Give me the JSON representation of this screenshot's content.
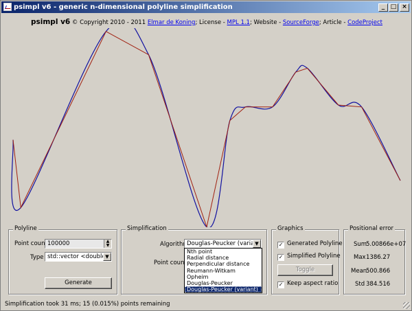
{
  "window": {
    "title": "psimpl v6 - generic n-dimensional polyline simplification",
    "controls": {
      "minimize": "_",
      "maximize": "□",
      "close": "×"
    }
  },
  "header": {
    "app_name": "psimpl v6",
    "copyright": " © Copyright 2010 - 2011 ",
    "author_link": "Elmar de Koning",
    "license_label": "; License - ",
    "license_link": "MPL 1.1",
    "website_label": "; Website - ",
    "website_link": "SourceForge",
    "article_label": "; Article - ",
    "article_link": "CodeProject"
  },
  "colors": {
    "generated": "#1010a0",
    "simplified": "#a02010",
    "selection": "#0a246a"
  },
  "plot": {
    "ymax": 1,
    "simplified_points": [
      [
        0.0,
        0.43
      ],
      [
        0.02,
        0.08
      ],
      [
        0.24,
        0.99
      ],
      [
        0.35,
        0.87
      ],
      [
        0.5,
        -0.02
      ],
      [
        0.56,
        0.53
      ],
      [
        0.6,
        0.6
      ],
      [
        0.67,
        0.6
      ],
      [
        0.73,
        0.78
      ],
      [
        0.76,
        0.8
      ],
      [
        0.84,
        0.61
      ],
      [
        0.9,
        0.6
      ],
      [
        1.0,
        0.22
      ]
    ]
  },
  "polyline": {
    "title": "Polyline",
    "point_count_label": "Point count",
    "point_count_value": "100000",
    "type_label": "Type",
    "type_value": "std::vector <double>",
    "generate_button": "Generate"
  },
  "simplification": {
    "title": "Simplification",
    "algorithm_label": "Algorithm",
    "algorithm_value": "Douglas-Peucker (variant)",
    "point_count_label": "Point count",
    "options": [
      "Nth point",
      "Radial distance",
      "Perpendicular distance",
      "Reumann-Witkam",
      "Opheim",
      "Douglas-Peucker",
      "Douglas-Peucker (variant)"
    ],
    "selected_index": 6
  },
  "graphics": {
    "title": "Graphics",
    "generated_label": "Generated Polyline",
    "simplified_label": "Simplified Polyline",
    "toggle_button": "Toggle",
    "keep_aspect_label": "Keep aspect ratio",
    "generated_checked": true,
    "simplified_checked": true,
    "keep_aspect_checked": true
  },
  "error": {
    "title": "Positional error",
    "sum_label": "Sum",
    "sum_value": "5.00866e+07",
    "max_label": "Max",
    "max_value": "1386.27",
    "mean_label": "Mean",
    "mean_value": "500.866",
    "std_label": "Std",
    "std_value": "384.516"
  },
  "status": {
    "text": "Simplification took 31 ms; 15 (0.015%) points remaining"
  }
}
